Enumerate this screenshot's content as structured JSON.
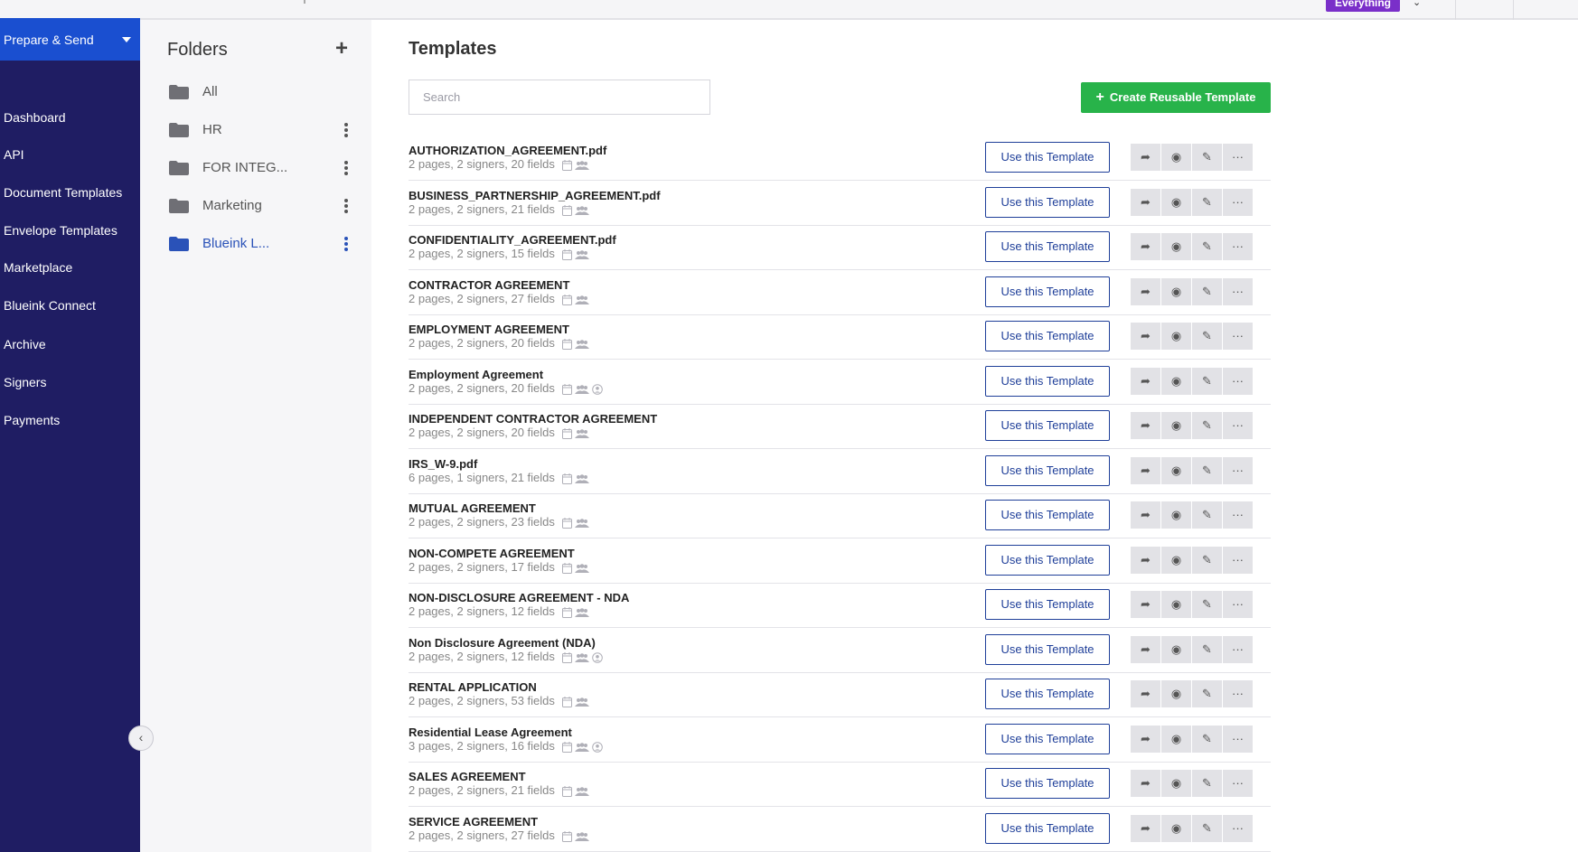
{
  "topbar": {
    "badge": "Everything"
  },
  "nav": {
    "prepare_label": "Prepare & Send",
    "items": [
      {
        "label": "Dashboard"
      },
      {
        "label": "API"
      },
      {
        "label": "Document Templates"
      },
      {
        "label": "Envelope Templates"
      },
      {
        "label": "Marketplace"
      },
      {
        "label": "Blueink Connect"
      },
      {
        "label": "Archive"
      },
      {
        "label": "Signers"
      },
      {
        "label": "Payments"
      }
    ],
    "collapse_glyph": "‹"
  },
  "folders": {
    "title": "Folders",
    "add_glyph": "+",
    "items": [
      {
        "label": "All",
        "active": false,
        "menu": false
      },
      {
        "label": "HR",
        "active": false,
        "menu": true
      },
      {
        "label": "FOR INTEG...",
        "active": false,
        "menu": true
      },
      {
        "label": "Marketing",
        "active": false,
        "menu": true
      },
      {
        "label": "Blueink L...",
        "active": true,
        "menu": true
      }
    ]
  },
  "main": {
    "title": "Templates",
    "search_placeholder": "Search",
    "create_label": "Create Reusable Template",
    "use_label": "Use this Template",
    "templates": [
      {
        "name": "AUTHORIZATION_AGREEMENT.pdf",
        "meta": "2 pages, 2 signers, 20 fields",
        "person": false
      },
      {
        "name": "BUSINESS_PARTNERSHIP_AGREEMENT.pdf",
        "meta": "2 pages, 2 signers, 21 fields",
        "person": false
      },
      {
        "name": "CONFIDENTIALITY_AGREEMENT.pdf",
        "meta": "2 pages, 2 signers, 15 fields",
        "person": false
      },
      {
        "name": "CONTRACTOR AGREEMENT",
        "meta": "2 pages, 2 signers, 27 fields",
        "person": false
      },
      {
        "name": "EMPLOYMENT AGREEMENT",
        "meta": "2 pages, 2 signers, 20 fields",
        "person": false
      },
      {
        "name": "Employment Agreement",
        "meta": "2 pages, 2 signers, 20 fields",
        "person": true
      },
      {
        "name": "INDEPENDENT CONTRACTOR AGREEMENT",
        "meta": "2 pages, 2 signers, 20 fields",
        "person": false
      },
      {
        "name": "IRS_W-9.pdf",
        "meta": "6 pages, 1 signers, 21 fields",
        "person": false
      },
      {
        "name": "MUTUAL AGREEMENT",
        "meta": "2 pages, 2 signers, 23 fields",
        "person": false
      },
      {
        "name": "NON-COMPETE AGREEMENT",
        "meta": "2 pages, 2 signers, 17 fields",
        "person": false
      },
      {
        "name": "NON-DISCLOSURE AGREEMENT - NDA",
        "meta": "2 pages, 2 signers, 12 fields",
        "person": false
      },
      {
        "name": "Non Disclosure Agreement (NDA)",
        "meta": "2 pages, 2 signers, 12 fields",
        "person": true
      },
      {
        "name": "RENTAL APPLICATION",
        "meta": "2 pages, 2 signers, 53 fields",
        "person": false
      },
      {
        "name": "Residential Lease Agreement",
        "meta": "3 pages, 2 signers, 16 fields",
        "person": true
      },
      {
        "name": "SALES AGREEMENT",
        "meta": "2 pages, 2 signers, 21 fields",
        "person": false
      },
      {
        "name": "SERVICE AGREEMENT",
        "meta": "2 pages, 2 signers, 27 fields",
        "person": false
      }
    ],
    "actions": [
      {
        "name": "share-icon",
        "glyph": "➦"
      },
      {
        "name": "preview-eye-icon",
        "glyph": "◉"
      },
      {
        "name": "edit-icon",
        "glyph": "✎"
      },
      {
        "name": "more-options-icon",
        "glyph": "···"
      }
    ]
  }
}
